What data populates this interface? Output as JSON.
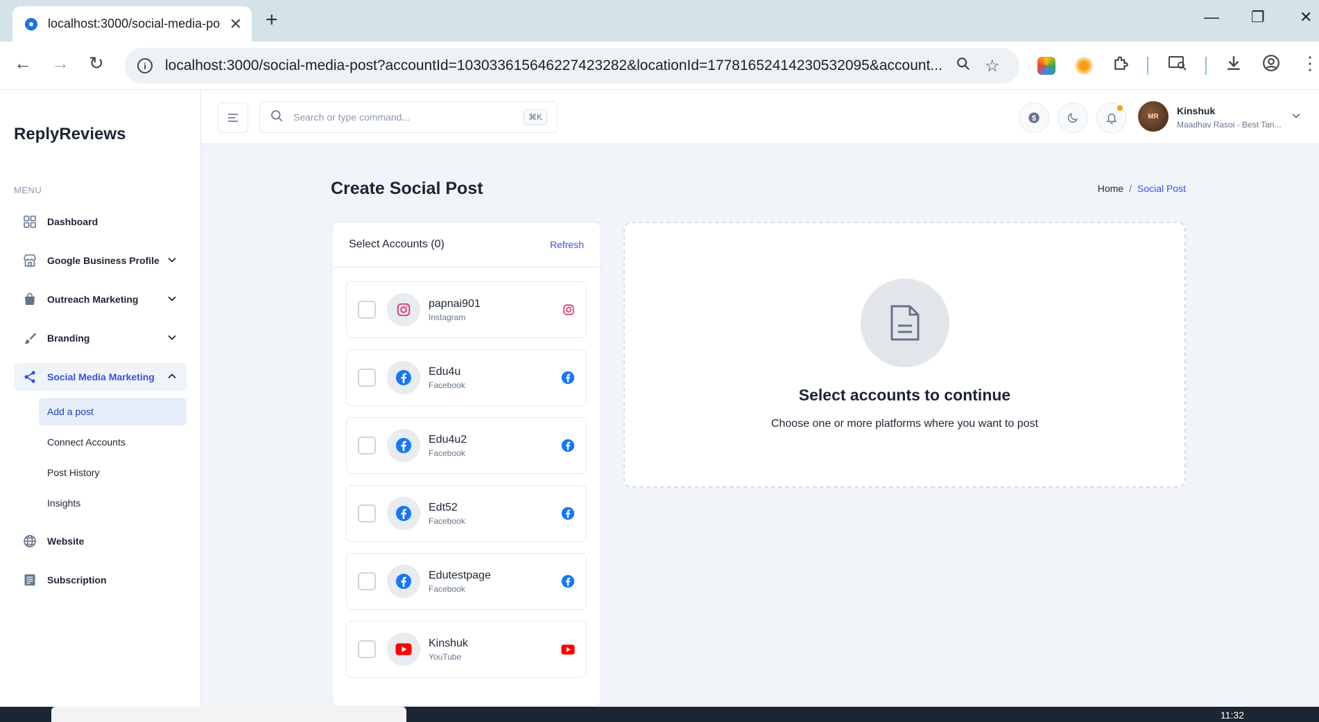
{
  "browser": {
    "tab_title": "localhost:3000/social-media-po",
    "url": "localhost:3000/social-media-post?accountId=103033615646227423282&locationId=17781652414230532095&account..."
  },
  "sidebar": {
    "logo": "ReplyReviews",
    "menu_label": "MENU",
    "items": [
      {
        "label": "Dashboard",
        "icon": "grid-icon"
      },
      {
        "label": "Google Business Profile",
        "icon": "store-icon"
      },
      {
        "label": "Outreach Marketing",
        "icon": "bag-icon"
      },
      {
        "label": "Branding",
        "icon": "brush-icon"
      },
      {
        "label": "Social Media Marketing",
        "icon": "share-icon"
      },
      {
        "label": "Website",
        "icon": "globe-icon"
      },
      {
        "label": "Subscription",
        "icon": "list-icon"
      }
    ],
    "sub_items": [
      {
        "label": "Add a post"
      },
      {
        "label": "Connect Accounts"
      },
      {
        "label": "Post History"
      },
      {
        "label": "Insights"
      }
    ]
  },
  "header": {
    "search_placeholder": "Search or type command...",
    "shortcut": "⌘K",
    "user_name": "Kinshuk",
    "user_sub": "Maadhav Rasoi - Best Tan..."
  },
  "page": {
    "title": "Create Social Post",
    "breadcrumb": {
      "home": "Home",
      "separator": "/",
      "current": "Social Post"
    }
  },
  "accounts_panel": {
    "title": "Select Accounts (0)",
    "refresh": "Refresh",
    "accounts": [
      {
        "name": "papnai901",
        "platform": "Instagram"
      },
      {
        "name": "Edu4u",
        "platform": "Facebook"
      },
      {
        "name": "Edu4u2",
        "platform": "Facebook"
      },
      {
        "name": "Edt52",
        "platform": "Facebook"
      },
      {
        "name": "Edutestpage",
        "platform": "Facebook"
      },
      {
        "name": "Kinshuk",
        "platform": "YouTube"
      }
    ]
  },
  "empty_state": {
    "title": "Select accounts to continue",
    "subtitle": "Choose one or more platforms where you want to post"
  },
  "taskbar": {
    "time": "11:32"
  },
  "colors": {
    "accent": "#3c50e0",
    "instagram": "#e1306c",
    "facebook": "#1877f2",
    "youtube": "#ff0000"
  }
}
